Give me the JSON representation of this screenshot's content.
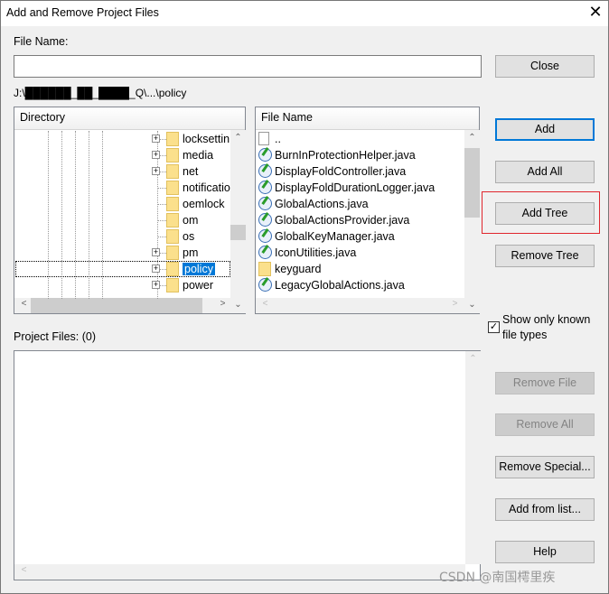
{
  "window": {
    "title": "Add and Remove Project Files",
    "close_icon": "close-icon"
  },
  "file_name": {
    "label": "File Name:",
    "value": ""
  },
  "path": "J:\\██████_██_████_Q\\...\\policy",
  "directory": {
    "header": "Directory",
    "items": [
      {
        "label": "locksettin",
        "expandable": true
      },
      {
        "label": "media",
        "expandable": true
      },
      {
        "label": "net",
        "expandable": true
      },
      {
        "label": "notificatio",
        "expandable": false
      },
      {
        "label": "oemlock",
        "expandable": false
      },
      {
        "label": "om",
        "expandable": false
      },
      {
        "label": "os",
        "expandable": false
      },
      {
        "label": "pm",
        "expandable": true
      },
      {
        "label": "policy",
        "expandable": true,
        "selected": true
      },
      {
        "label": "power",
        "expandable": true
      }
    ]
  },
  "files": {
    "header": "File Name",
    "items": [
      {
        "label": "..",
        "type": "parent"
      },
      {
        "label": "BurnInProtectionHelper.java",
        "type": "java"
      },
      {
        "label": "DisplayFoldController.java",
        "type": "java"
      },
      {
        "label": "DisplayFoldDurationLogger.java",
        "type": "java"
      },
      {
        "label": "GlobalActions.java",
        "type": "java"
      },
      {
        "label": "GlobalActionsProvider.java",
        "type": "java"
      },
      {
        "label": "GlobalKeyManager.java",
        "type": "java"
      },
      {
        "label": "IconUtilities.java",
        "type": "java"
      },
      {
        "label": "keyguard",
        "type": "folder"
      },
      {
        "label": "LegacyGlobalActions.java",
        "type": "java"
      }
    ]
  },
  "buttons": {
    "close": "Close",
    "add": "Add",
    "add_all": "Add All",
    "add_tree": "Add Tree",
    "remove_tree": "Remove Tree",
    "remove_file": "Remove File",
    "remove_all": "Remove All",
    "remove_special": "Remove Special...",
    "add_from_list": "Add from list...",
    "help": "Help"
  },
  "show_known": {
    "label": "Show only known file types",
    "checked": true
  },
  "project_files": {
    "label": "Project Files: (0)"
  },
  "watermark": "CSDN @南国樗里疾",
  "colors": {
    "highlight": "#0078d7",
    "annotation_box": "#e0262d"
  }
}
